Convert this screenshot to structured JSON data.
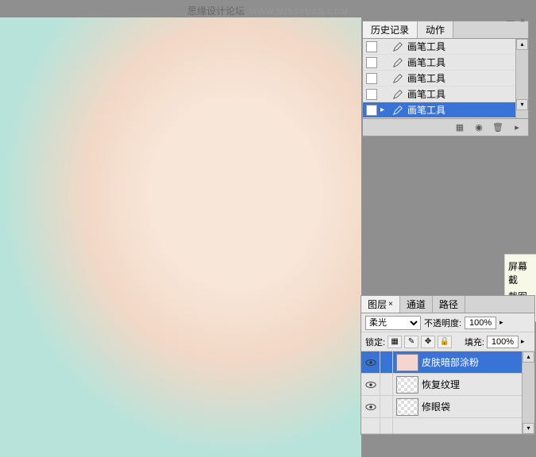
{
  "watermark": {
    "text": "思缘设计论坛",
    "url": "WWW.MISSYUAN.COM"
  },
  "history": {
    "tabs": {
      "history": "历史记录",
      "actions": "动作"
    },
    "items": [
      {
        "label": "画笔工具",
        "selected": false,
        "marker": ""
      },
      {
        "label": "画笔工具",
        "selected": false,
        "marker": ""
      },
      {
        "label": "画笔工具",
        "selected": false,
        "marker": ""
      },
      {
        "label": "画笔工具",
        "selected": false,
        "marker": ""
      },
      {
        "label": "画笔工具",
        "selected": true,
        "marker": "▸"
      }
    ]
  },
  "screenshot_hint": {
    "row1": "屏幕截",
    "row2": "截图时"
  },
  "layers": {
    "tabs": {
      "layers": "图层",
      "channels": "通道",
      "paths": "路径"
    },
    "blend_mode": "柔光",
    "opacity_label": "不透明度:",
    "opacity_value": "100%",
    "lock_label": "锁定:",
    "fill_label": "填充:",
    "fill_value": "100%",
    "items": [
      {
        "name": "皮肤暗部涂粉",
        "selected": true,
        "visible": true,
        "thumb": "pink"
      },
      {
        "name": "恢复纹理",
        "selected": false,
        "visible": true,
        "thumb": "checker"
      },
      {
        "name": "修眼袋",
        "selected": false,
        "visible": true,
        "thumb": "checker"
      }
    ]
  }
}
